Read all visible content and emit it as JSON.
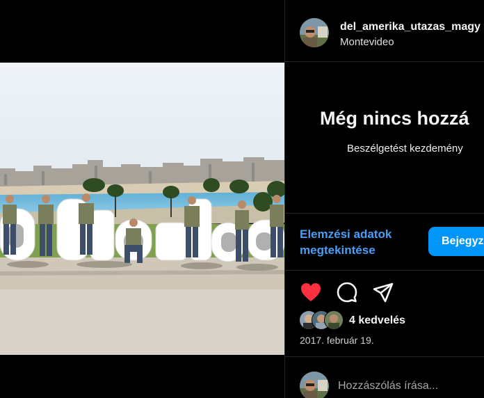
{
  "post": {
    "username": "del_amerika_utazas_magy",
    "location": "Montevideo",
    "photo_icon": "montevideo-sign-photo"
  },
  "comments": {
    "empty_title": "Még nincs hozzá",
    "empty_subtitle": "Beszélgetést kezdemény"
  },
  "insights": {
    "link_label": "Elemzési adatok megtekintése",
    "button_label": "Bejegyz"
  },
  "actions": {
    "like_icon": "heart-icon",
    "comment_icon": "comment-icon",
    "share_icon": "send-icon",
    "like_color": "#ff3040"
  },
  "likes": {
    "count_label": "4 kedvelés"
  },
  "date": "2017. február 19.",
  "comment_input": {
    "placeholder": "Hozzászólás írása..."
  },
  "colors": {
    "background": "#000000",
    "link": "#4a9ff5",
    "primary_button": "#0095f6"
  }
}
